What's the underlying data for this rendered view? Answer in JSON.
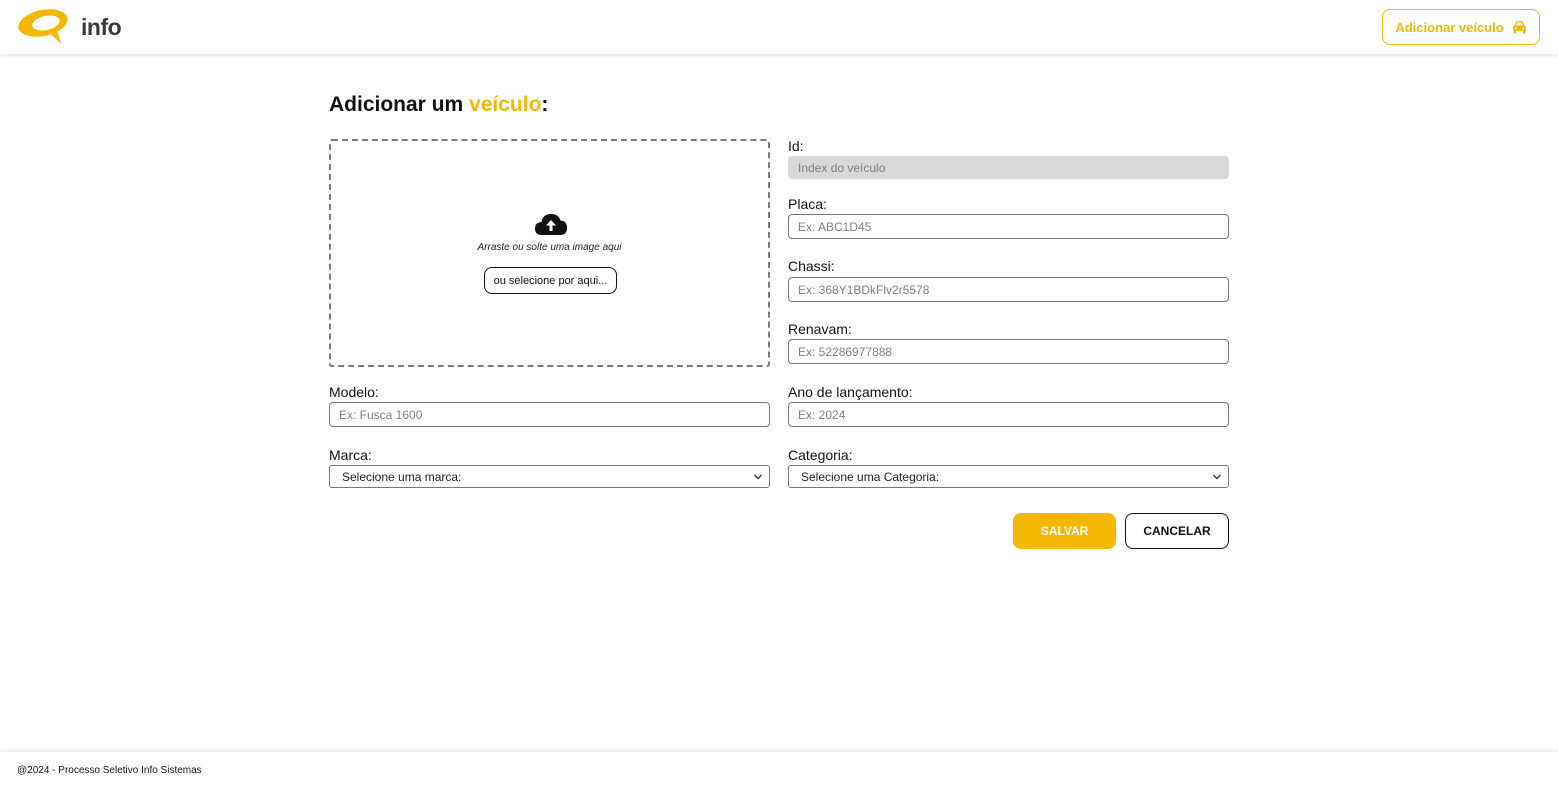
{
  "header": {
    "logo_text": "info",
    "add_vehicle_label": "Adicionar veículo",
    "add_vehicle_icon": "car-icon"
  },
  "form": {
    "title_prefix": "Adicionar um ",
    "title_accent": "veículo",
    "title_suffix": ":",
    "dropzone": {
      "icon": "cloud-upload-icon",
      "text": "Arraste ou solte uma image aqui",
      "button_label": "ou selecione por aqui..."
    },
    "id": {
      "label": "Id:",
      "placeholder": "Index do veículo"
    },
    "placa": {
      "label": "Placa:",
      "placeholder": "Ex: ABC1D45"
    },
    "chassi": {
      "label": "Chassi:",
      "placeholder": "Ex: 368Y1BDkFlv2r5578"
    },
    "renavam": {
      "label": "Renavam:",
      "placeholder": "Ex: 52286977888"
    },
    "modelo": {
      "label": "Modelo:",
      "placeholder": "Ex: Fusca 1600"
    },
    "ano": {
      "label": "Ano de lançamento:",
      "placeholder": "Ex: 2024"
    },
    "marca": {
      "label": "Marca:",
      "selected": "Selecione uma marca:"
    },
    "categoria": {
      "label": "Categoria:",
      "selected": "Selecione uma Categoria:"
    },
    "save_label": "SALVAR",
    "cancel_label": "CANCELAR"
  },
  "footer": {
    "text": "@2024 - Processo Seletivo Info Sistemas"
  },
  "colors": {
    "accent": "#f5b800",
    "text": "#111111",
    "disabled_input": "#d9d9d9"
  }
}
